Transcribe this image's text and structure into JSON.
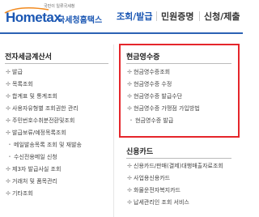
{
  "header": {
    "logo_tagline": "국민이 일류국세청",
    "logo_name": "Hometax",
    "logo_sub": "국세청홈택스",
    "tabs": [
      {
        "label": "조회/발급"
      },
      {
        "label": "민원증명"
      },
      {
        "label": "신청/제출"
      }
    ]
  },
  "left_column": {
    "title": "전자세금계산서",
    "items": [
      {
        "label": "발급",
        "sub": false
      },
      {
        "label": "목록조회",
        "sub": false
      },
      {
        "label": "합계표 및 통계조회",
        "sub": false
      },
      {
        "label": "사용자유형별 조회권한 관리",
        "sub": false
      },
      {
        "label": "주민번호수취분전환및조회",
        "sub": false
      },
      {
        "label": "발급보류/예정목록조회",
        "sub": false
      },
      {
        "label": "메일발송목록 조회 및 재발송",
        "sub": true
      },
      {
        "label": "수신전용메일 신청",
        "sub": true
      },
      {
        "label": "제3자 발급사실 조회",
        "sub": false
      },
      {
        "label": "거래처 및 품목관리",
        "sub": false
      },
      {
        "label": "기타조회",
        "sub": false
      }
    ]
  },
  "right_column": {
    "cash_receipt": {
      "title": "현금영수증",
      "items": [
        {
          "label": "현금영수증조회",
          "sub": false
        },
        {
          "label": "현금영수증 수정",
          "sub": false
        },
        {
          "label": "현금영수증 발급수단",
          "sub": false
        },
        {
          "label": "현금영수증 가맹점 가입방법",
          "sub": false
        },
        {
          "label": "현금영수증 발급",
          "sub": true
        }
      ]
    },
    "credit_card": {
      "title": "신용카드",
      "items": [
        {
          "label": "신용카드/판매(결제)대행매출자료조회",
          "sub": false
        },
        {
          "label": "사업용신용카드",
          "sub": false
        },
        {
          "label": "화물운전자복지카드",
          "sub": false
        },
        {
          "label": "납세관리인 조회 서비스",
          "sub": false
        }
      ]
    }
  },
  "colors": {
    "brand_blue": "#1b57b3",
    "highlight_red": "#e5262b",
    "accent_orange": "#f28a1e"
  }
}
